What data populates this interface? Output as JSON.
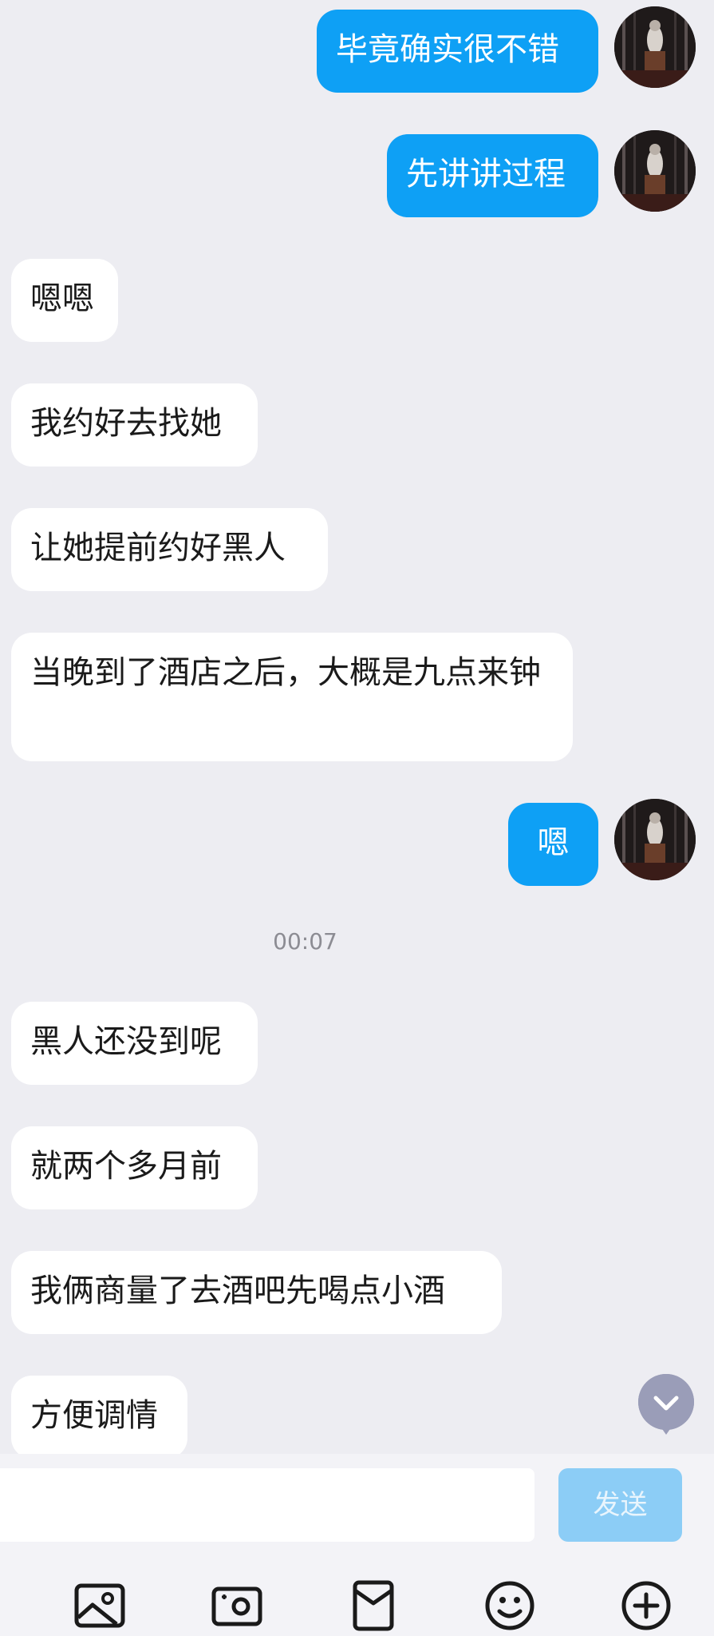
{
  "messages": [
    {
      "side": "out",
      "text": "毕竟确实很不错"
    },
    {
      "side": "out",
      "text": "先讲讲过程"
    },
    {
      "side": "in",
      "text": "嗯嗯"
    },
    {
      "side": "in",
      "text": "我约好去找她"
    },
    {
      "side": "in",
      "text": "让她提前约好黑人"
    },
    {
      "side": "in",
      "text": "当晚到了酒店之后，大概是九点来钟"
    },
    {
      "side": "out",
      "text": "嗯"
    },
    {
      "side": "in",
      "text": "黑人还没到呢"
    },
    {
      "side": "in",
      "text": "就两个多月前"
    },
    {
      "side": "in",
      "text": "我俩商量了去酒吧先喝点小酒"
    },
    {
      "side": "in",
      "text": "方便调情"
    }
  ],
  "timestamp": "00:07",
  "composer": {
    "placeholder": "",
    "send_label": "发送"
  },
  "toolbar": {
    "icons": [
      "image-icon",
      "camera-icon",
      "red-packet-icon",
      "emoji-icon",
      "plus-icon"
    ]
  },
  "colors": {
    "background": "#ededf2",
    "outgoing_bubble": "#0ea0f5",
    "incoming_bubble": "#ffffff",
    "send_button_disabled": "#8ccdf6"
  }
}
